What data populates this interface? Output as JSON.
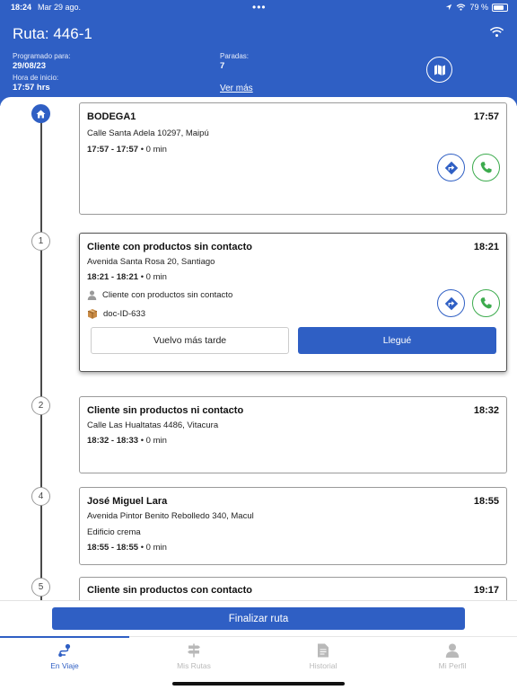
{
  "status_bar": {
    "time": "18:24",
    "date": "Mar 29 ago.",
    "dots": "•••",
    "battery": "79 %",
    "battery_level": 0.79
  },
  "header": {
    "route_title": "Ruta: 446-1",
    "scheduled_label": "Programado para:",
    "scheduled_value": "29/08/23",
    "start_label": "Hora de inicio:",
    "start_value": "17:57 hrs",
    "stops_label": "Paradas:",
    "stops_value": "7",
    "see_more": "Ver más"
  },
  "stops": [
    {
      "marker": "",
      "name": "BODEGA1",
      "time": "17:57",
      "address": "Calle Santa Adela 10297, Maipú",
      "range": "17:57 - 17:57",
      "duration": "• 0 min"
    },
    {
      "marker": "1",
      "name": "Cliente con productos sin contacto",
      "time": "18:21",
      "address": "Avenida Santa Rosa 20, Santiago",
      "range": "18:21 - 18:21",
      "duration": "• 0 min",
      "contact": "Cliente con productos sin contacto",
      "document": "doc-ID-633",
      "later_label": "Vuelvo más tarde",
      "arrived_label": "Llegué"
    },
    {
      "marker": "2",
      "name": "Cliente sin productos ni contacto",
      "time": "18:32",
      "address": "Calle Las Hualtatas 4486, Vitacura",
      "range": "18:32 - 18:33",
      "duration": "• 0 min"
    },
    {
      "marker": "4",
      "name": "José Miguel Lara",
      "time": "18:55",
      "address": "Avenida Pintor Benito Rebolledo 340, Macul",
      "note": "Edificio crema",
      "range": "18:55 - 18:55",
      "duration": "• 0 min"
    },
    {
      "marker": "5",
      "name": "Cliente sin productos con contacto",
      "time": "19:17"
    }
  ],
  "finish_button": "Finalizar ruta",
  "tabs": [
    {
      "label": "En Viaje",
      "icon": "route-icon",
      "active": true
    },
    {
      "label": "Mis Rutas",
      "icon": "signpost-icon",
      "active": false
    },
    {
      "label": "Historial",
      "icon": "document-icon",
      "active": false
    },
    {
      "label": "Mi Perfil",
      "icon": "person-icon",
      "active": false
    }
  ],
  "colors": {
    "primary": "#2f5fc4",
    "phone_green": "#3cab4d",
    "inactive_tab": "#b9b9b9"
  }
}
